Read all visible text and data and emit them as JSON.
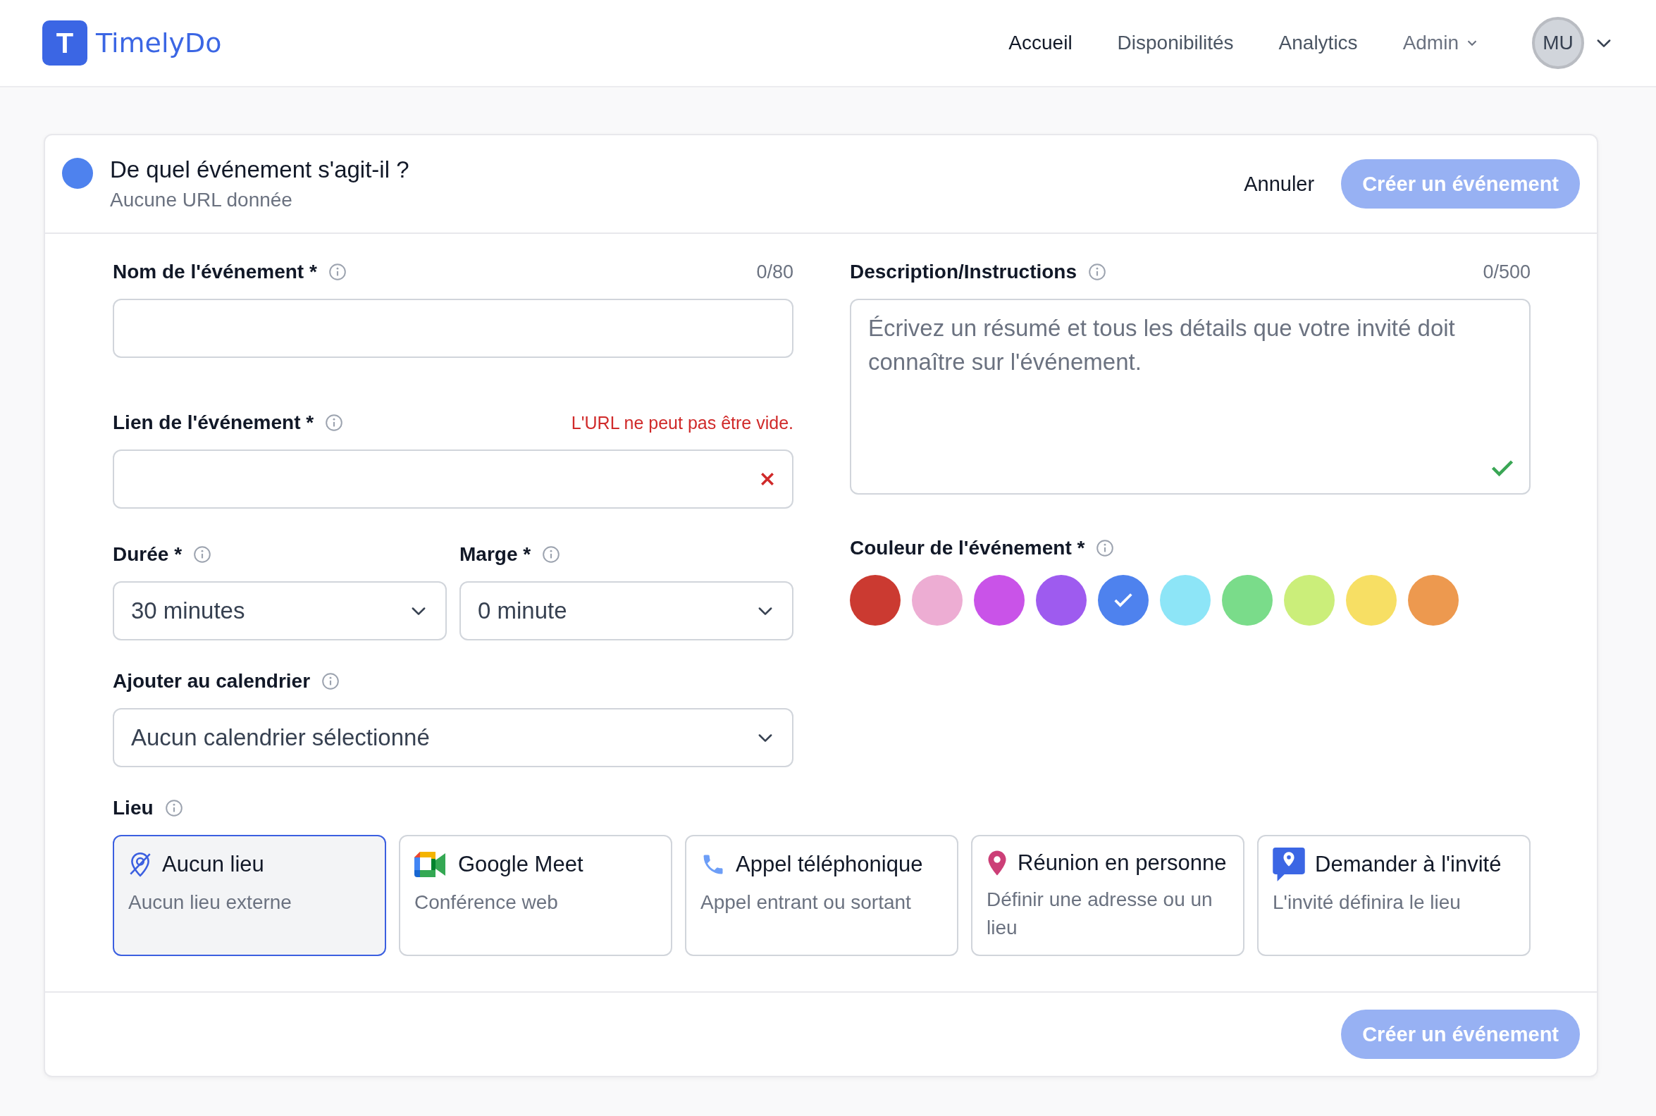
{
  "brand": {
    "logo_letter": "T",
    "name": "TimelyDo"
  },
  "nav": [
    {
      "label": "Accueil",
      "selected": true,
      "dropdown": false
    },
    {
      "label": "Disponibilités",
      "selected": false,
      "dropdown": false
    },
    {
      "label": "Analytics",
      "selected": false,
      "dropdown": false
    },
    {
      "label": "Admin",
      "selected": false,
      "dropdown": true
    }
  ],
  "user": {
    "initials": "MU"
  },
  "header": {
    "title": "De quel événement s'agit-il ?",
    "subtitle": "Aucune URL donnée",
    "cancel": "Annuler",
    "create": "Créer un événement"
  },
  "name_field": {
    "label": "Nom de l'événement *",
    "counter": "0/80"
  },
  "link_field": {
    "label": "Lien de l'événement *",
    "error": "L'URL ne peut pas être vide.",
    "invalid": true
  },
  "description_field": {
    "label": "Description/Instructions",
    "counter": "0/500",
    "placeholder": "Écrivez un résumé et tous les détails que votre invité doit connaître sur l'événement.",
    "valid": true
  },
  "duration": {
    "label": "Durée *",
    "value": "30 minutes"
  },
  "margin": {
    "label": "Marge *",
    "value": "0 minute"
  },
  "calendar": {
    "label": "Ajouter au calendrier",
    "value": "Aucun calendrier sélectionné"
  },
  "event_color": {
    "label": "Couleur de l'événement *",
    "colors": [
      {
        "color": "#cb3a31",
        "selected": false
      },
      {
        "color": "#edadd3",
        "selected": false
      },
      {
        "color": "#c953e8",
        "selected": false
      },
      {
        "color": "#9e5bef",
        "selected": false
      },
      {
        "color": "#4e82ee",
        "selected": true
      },
      {
        "color": "#8de5f7",
        "selected": false
      },
      {
        "color": "#7adc8a",
        "selected": false
      },
      {
        "color": "#cbee7a",
        "selected": false
      },
      {
        "color": "#f7df64",
        "selected": false
      },
      {
        "color": "#ed994f",
        "selected": false
      }
    ]
  },
  "location": {
    "label": "Lieu",
    "options": [
      {
        "kind": "none",
        "title": "Aucun lieu",
        "subtitle": "Aucun lieu externe",
        "selected": true
      },
      {
        "kind": "meet",
        "title": "Google Meet",
        "subtitle": "Conférence web",
        "selected": false
      },
      {
        "kind": "phone",
        "title": "Appel téléphonique",
        "subtitle": "Appel entrant ou sortant",
        "selected": false
      },
      {
        "kind": "in_person",
        "title": "Réunion en personne",
        "subtitle": "Définir une adresse ou un lieu",
        "selected": false
      },
      {
        "kind": "ask",
        "title": "Demander à l'invité",
        "subtitle": "L'invité définira le lieu",
        "selected": false
      }
    ]
  },
  "footer": {
    "create": "Créer un événement"
  }
}
